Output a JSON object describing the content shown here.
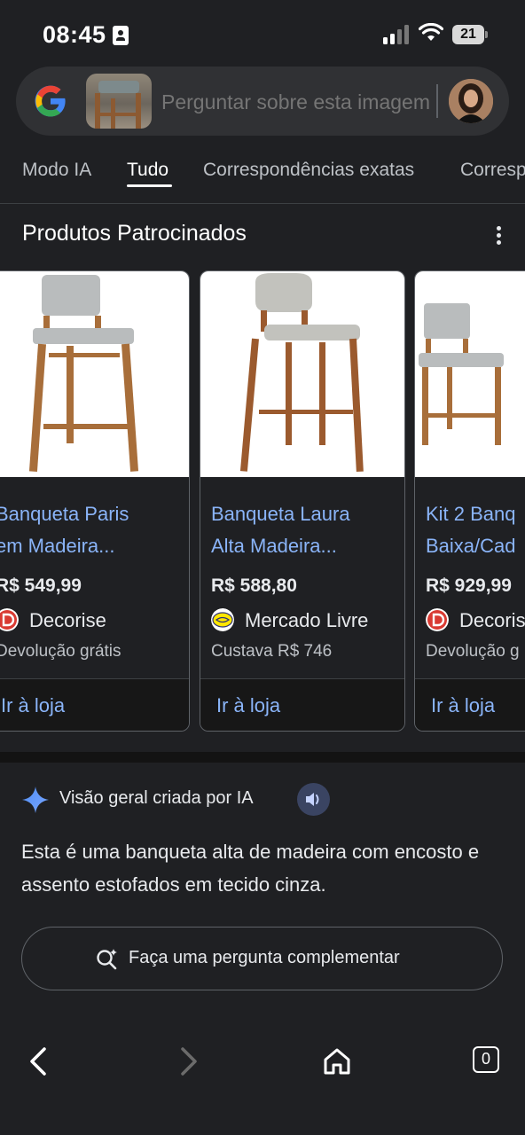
{
  "status_bar": {
    "time": "08:45",
    "battery": "21"
  },
  "search": {
    "placeholder": "Perguntar sobre esta imagem"
  },
  "tabs": [
    {
      "label": "Modo IA",
      "active": false
    },
    {
      "label": "Tudo",
      "active": true
    },
    {
      "label": "Correspondências exatas",
      "active": false
    },
    {
      "label": "Corresp",
      "active": false
    }
  ],
  "sponsored": {
    "title": "Produtos Patrocinados",
    "products": [
      {
        "title_line1": "Banqueta Paris",
        "title_line2": "em Madeira...",
        "price": "R$ 549,99",
        "store": "Decorise",
        "note": "Devolução grátis",
        "link": "Ir à loja"
      },
      {
        "title_line1": "Banqueta Laura",
        "title_line2": "Alta Madeira...",
        "price": "R$ 588,80",
        "store": "Mercado Livre",
        "note": "Custava R$ 746",
        "link": "Ir à loja"
      },
      {
        "title_line1": "Kit 2 Banq",
        "title_line2": "Baixa/Cad",
        "price": "R$ 929,99",
        "store": "Decoris",
        "note": "Devolução g",
        "link": "Ir à loja"
      }
    ]
  },
  "ai_overview": {
    "title": "Visão geral criada por IA",
    "text": "Esta é uma banqueta alta de madeira com encosto e assento estofados em tecido cinza.",
    "followup_label": "Faça uma pergunta complementar"
  },
  "bottom_nav": {
    "tabs_count": "0"
  },
  "colors": {
    "background": "#1f2023",
    "link": "#8ab4f8",
    "search_bg": "#303134"
  }
}
